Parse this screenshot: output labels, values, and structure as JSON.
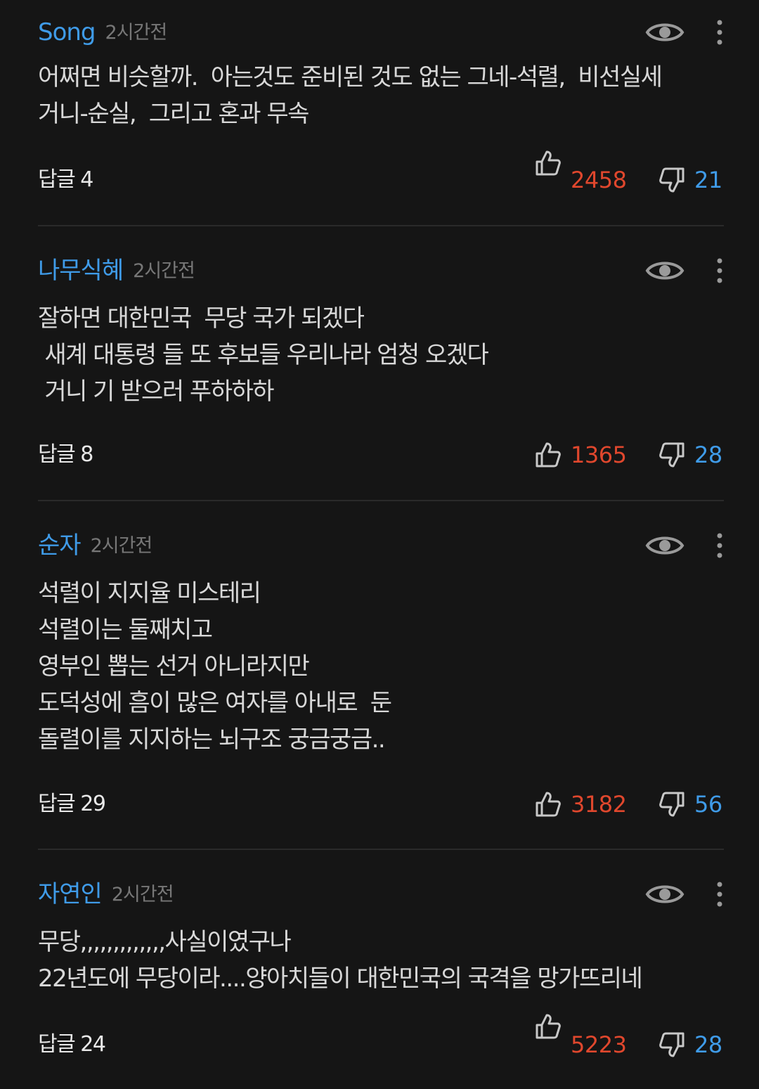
{
  "colors": {
    "background": "#151515",
    "author": "#3f9be8",
    "like_count": "#e0472d",
    "dislike_count": "#3f9be8",
    "time": "#777777",
    "body_text": "#d8d8d8"
  },
  "icons": {
    "view": "eye-icon",
    "more": "more-vertical-icon",
    "like": "thumbs-up-icon",
    "dislike": "thumbs-down-icon"
  },
  "comments": [
    {
      "author": "Song",
      "time": "2시간전",
      "body": "어쩌면 비슷할까.  아는것도 준비된 것도 없는 그네-석렬,  비선실세\n거니-순실,  그리고 혼과 무속",
      "reply": "답글 4",
      "likes": "2458",
      "dislikes": "21"
    },
    {
      "author": "나무식혜",
      "time": "2시간전",
      "body": "잘하면 대한민국  무당 국가 되겠다\n 새계 대통령 들 또 후보들 우리나라 엄청 오겠다\n 거니 기 받으러 푸하하하",
      "reply": "답글 8",
      "likes": "1365",
      "dislikes": "28"
    },
    {
      "author": "순자",
      "time": "2시간전",
      "body": "석렬이 지지율 미스테리\n석렬이는 둘째치고\n영부인 뽑는 선거 아니라지만\n도덕성에 흠이 많은 여자를 아내로  둔\n돌렬이를 지지하는 뇌구조 궁금궁금..",
      "reply": "답글 29",
      "likes": "3182",
      "dislikes": "56"
    },
    {
      "author": "자연인",
      "time": "2시간전",
      "body": "무당,,,,,,,,,,,,,사실이였구나\n22년도에 무당이라....양아치들이 대한민국의 국격을 망가뜨리네",
      "reply": "답글 24",
      "likes": "5223",
      "dislikes": "28"
    }
  ]
}
